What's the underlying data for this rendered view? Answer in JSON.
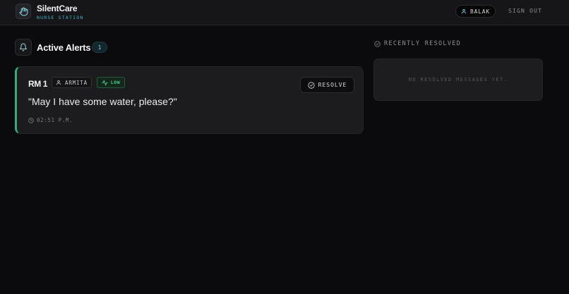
{
  "app": {
    "name": "SilentCare",
    "subtitle": "NURSE STATION"
  },
  "header": {
    "user_name": "BALAK",
    "signout_label": "SIGN OUT"
  },
  "alerts": {
    "title": "Active Alerts",
    "count": "1",
    "items": [
      {
        "room": "RM 1",
        "patient": "ARMITA",
        "priority": "LOW",
        "resolve_label": "RESOLVE",
        "message": "\"May I have some water, please?\"",
        "time": "02:51 P.M."
      }
    ]
  },
  "resolved": {
    "title": "RECENTLY RESOLVED",
    "empty_text": "NO RESOLVED MESSAGES YET."
  },
  "colors": {
    "accent_cyan": "#3fb0c4",
    "priority_low": "#45d18a",
    "card_border_accent": "#2fb07a"
  },
  "icons": {
    "logo": "hand-icon",
    "user": "user-icon",
    "bell": "bell-icon",
    "activity": "activity-icon",
    "resolve": "check-circle-icon",
    "clock": "clock-icon"
  }
}
